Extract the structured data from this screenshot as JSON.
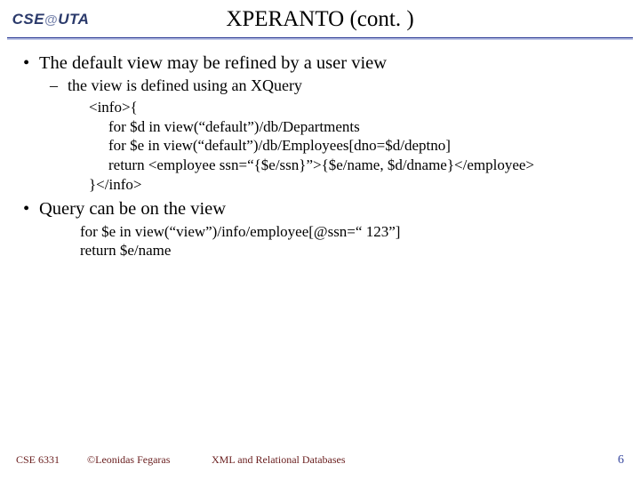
{
  "logo": {
    "text_left": "CSE",
    "text_mid": "@",
    "text_right": "UTA"
  },
  "title": "XPERANTO (cont. )",
  "bullets": {
    "b1": "The default view may be refined by a user view",
    "b1_sub": "the view is defined using an XQuery",
    "b2": "Query can be on the view"
  },
  "code1": {
    "l1": "<info>{",
    "l2": "for $d in view(“default”)/db/Departments",
    "l3": "for $e in view(“default”)/db/Employees[dno=$d/deptno]",
    "l4": "return <employee ssn=“{$e/ssn}”>{$e/name, $d/dname}</employee>",
    "l5": "}</info>"
  },
  "code2": {
    "l1": "for $e in view(“view”)/info/employee[@ssn=“ 123”]",
    "l2": "return $e/name"
  },
  "footer": {
    "course": "CSE 6331",
    "copyright": "©Leonidas Fegaras",
    "topic": "XML and Relational Databases",
    "page": "6"
  }
}
